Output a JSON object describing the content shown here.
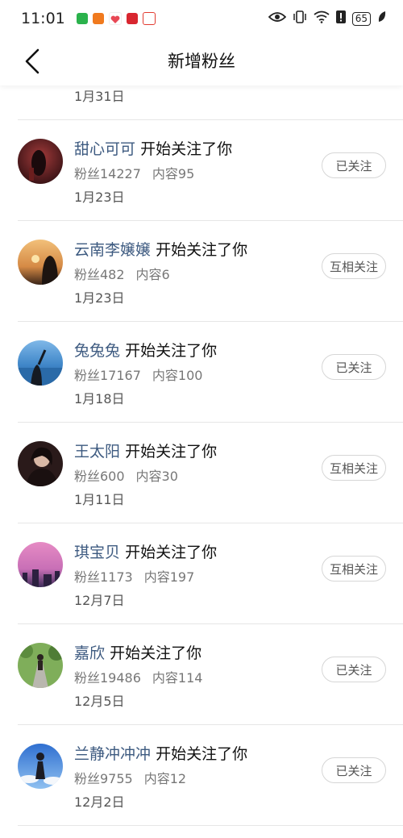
{
  "status_bar": {
    "time": "11:01",
    "battery": "65",
    "app_icon_colors": [
      "#2bb24c",
      "#f07a1e",
      "#e84855",
      "#d8262f",
      "#e23b30"
    ]
  },
  "header": {
    "title": "新增粉丝"
  },
  "partial_top": {
    "date": "1月31日"
  },
  "items": [
    {
      "name": "甜心可可",
      "action": "开始关注了你",
      "fans": "粉丝14227",
      "content": "内容95",
      "date": "1月23日",
      "button": "已关注"
    },
    {
      "name": "云南李嬢嬢",
      "action": "开始关注了你",
      "fans": "粉丝482",
      "content": "内容6",
      "date": "1月23日",
      "button": "互相关注"
    },
    {
      "name": "兔兔兔",
      "action": "开始关注了你",
      "fans": "粉丝17167",
      "content": "内容100",
      "date": "1月18日",
      "button": "已关注"
    },
    {
      "name": "王太阳",
      "action": "开始关注了你",
      "fans": "粉丝600",
      "content": "内容30",
      "date": "1月11日",
      "button": "互相关注"
    },
    {
      "name": "琪宝贝",
      "action": "开始关注了你",
      "fans": "粉丝1173",
      "content": "内容197",
      "date": "12月7日",
      "button": "互相关注"
    },
    {
      "name": "嘉欣",
      "action": "开始关注了你",
      "fans": "粉丝19486",
      "content": "内容114",
      "date": "12月5日",
      "button": "已关注"
    },
    {
      "name": "兰静冲冲冲",
      "action": "开始关注了你",
      "fans": "粉丝9755",
      "content": "内容12",
      "date": "12月2日",
      "button": "已关注"
    }
  ]
}
